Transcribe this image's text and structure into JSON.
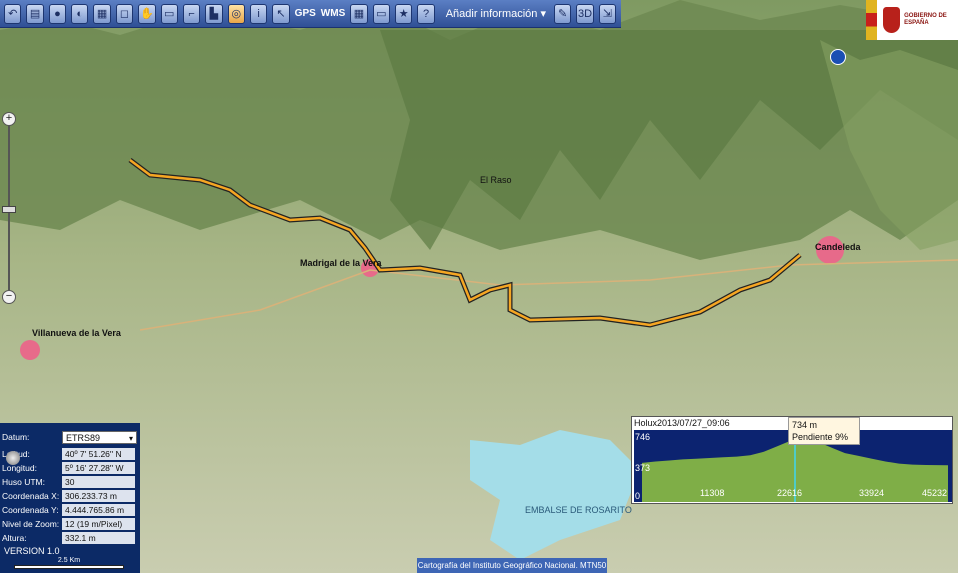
{
  "toolbar": {
    "buttons": [
      "back",
      "layers",
      "globe",
      "sphere",
      "map",
      "zoom-in-box",
      "pan",
      "measure",
      "distance",
      "area",
      "info",
      "info-circle",
      "pointer"
    ],
    "gps_label": "GPS",
    "wms_label": "WMS",
    "add_info_label": "Añadir información"
  },
  "logo": {
    "text": "GOBIERNO DE ESPAÑA"
  },
  "map_labels": {
    "candeleda": "Candeleda",
    "madrigal": "Madrigal de la Vera",
    "villanueva": "Villanueva de la Vera",
    "embalse": "EMBALSE DE ROSARITO",
    "el_raso": "El Raso"
  },
  "coords_panel": {
    "datum_label": "Datum:",
    "datum_value": "ETRS89",
    "lat_label": "Latitud:",
    "lat_value": "40º 7' 51.26'' N",
    "lon_label": "Longitud:",
    "lon_value": "5º 16' 27.28'' W",
    "huso_label": "Huso UTM:",
    "huso_value": "30",
    "x_label": "Coordenada X:",
    "x_value": "306.233.73 m",
    "y_label": "Coordenada Y:",
    "y_value": "4.444.765.86 m",
    "zoom_label": "Nivel de Zoom:",
    "zoom_value": "12 (19 m/Pixel)",
    "alt_label": "Altura:",
    "alt_value": "332.1 m",
    "version": "VERSION 1.0",
    "scale": "2.5 Km"
  },
  "attribution": "Cartografía del Instituto Geográfico Nacional. MTN50",
  "profile": {
    "title": "Holux2013/07/27_09:06",
    "tooltip_alt": "734 m",
    "tooltip_slope": "Pendiente 9%",
    "y_ticks": [
      "746",
      "373",
      "0"
    ],
    "x_ticks": [
      "11308",
      "22616",
      "33924",
      "45232"
    ],
    "cursor_x": 22616,
    "x_max": 45232,
    "y_max": 746,
    "elevation": [
      [
        0,
        360
      ],
      [
        2000,
        380
      ],
      [
        4000,
        395
      ],
      [
        6000,
        410
      ],
      [
        8000,
        420
      ],
      [
        10000,
        430
      ],
      [
        12000,
        440
      ],
      [
        14000,
        450
      ],
      [
        16000,
        470
      ],
      [
        18000,
        520
      ],
      [
        20000,
        600
      ],
      [
        21500,
        660
      ],
      [
        22616,
        734
      ],
      [
        24000,
        690
      ],
      [
        25500,
        650
      ],
      [
        27000,
        620
      ],
      [
        28500,
        560
      ],
      [
        30000,
        500
      ],
      [
        32000,
        460
      ],
      [
        34000,
        420
      ],
      [
        36000,
        380
      ],
      [
        38000,
        350
      ],
      [
        40000,
        335
      ],
      [
        42000,
        330
      ],
      [
        45232,
        325
      ]
    ],
    "colors": {
      "fill": "#7fae47",
      "background": "#0c2370",
      "cursor": "#3fd7f0"
    }
  },
  "colors": {
    "track": "#f5a623",
    "toolbar": "#3a5aa8",
    "panel": "#0c2a66"
  }
}
